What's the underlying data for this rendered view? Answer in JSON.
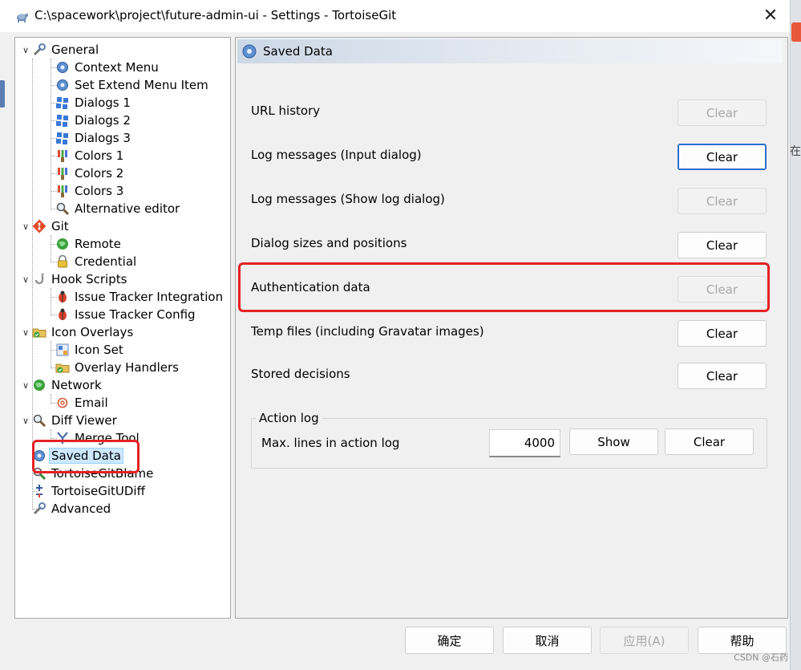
{
  "window": {
    "title": "C:\\spacework\\project\\future-admin-ui - Settings - TortoiseGit",
    "close_glyph": "✕",
    "app_icon": "tortoise-icon"
  },
  "tree": {
    "general": "General",
    "context_menu": "Context Menu",
    "set_extend_menu_item": "Set Extend Menu Item",
    "dialogs_1": "Dialogs 1",
    "dialogs_2": "Dialogs 2",
    "dialogs_3": "Dialogs 3",
    "colors_1": "Colors 1",
    "colors_2": "Colors 2",
    "colors_3": "Colors 3",
    "alternative_editor": "Alternative editor",
    "git": "Git",
    "remote": "Remote",
    "credential": "Credential",
    "hook_scripts": "Hook Scripts",
    "issue_tracker_integration": "Issue Tracker Integration",
    "issue_tracker_config": "Issue Tracker Config",
    "icon_overlays": "Icon Overlays",
    "icon_set": "Icon Set",
    "overlay_handlers": "Overlay Handlers",
    "network": "Network",
    "email": "Email",
    "diff_viewer": "Diff Viewer",
    "merge_tool": "Merge Tool",
    "saved_data": "Saved Data",
    "tortoisegitblame": "TortoiseGitBlame",
    "tortoisegitudiff": "TortoiseGitUDiff",
    "advanced": "Advanced",
    "expand_glyph": "∨"
  },
  "page": {
    "title": "Saved Data",
    "rows": {
      "url_history": "URL history",
      "log_messages_input": "Log messages (Input dialog)",
      "log_messages_show": "Log messages (Show log dialog)",
      "dialog_sizes": "Dialog sizes and positions",
      "authentication": "Authentication data",
      "temp_files": "Temp files (including Gravatar images)",
      "stored_decisions": "Stored decisions"
    },
    "clear_label": "Clear",
    "action_log": {
      "legend": "Action log",
      "max_lines_label": "Max. lines in action log",
      "max_lines_value": "4000",
      "show_label": "Show",
      "clear_label": "Clear"
    }
  },
  "footer": {
    "ok": "确定",
    "cancel": "取消",
    "apply": "应用(A)",
    "help": "帮助"
  },
  "right_strip": {
    "glyph": "在"
  },
  "watermark": "CSDN @石药",
  "colors": {
    "highlight_red": "#e52222",
    "selection_bg": "#cce8ff",
    "focus_blue": "#2a6fd1"
  }
}
